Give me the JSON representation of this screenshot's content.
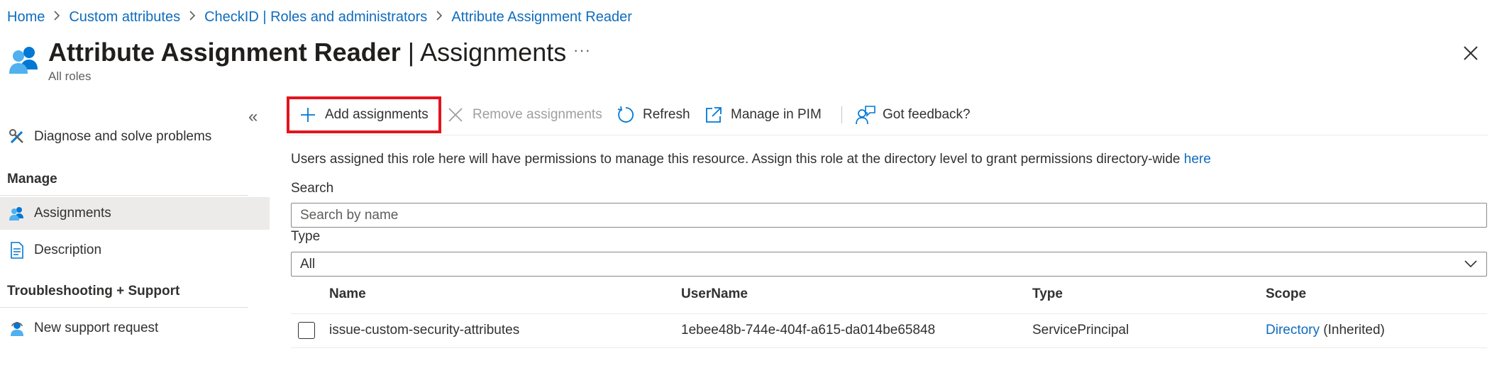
{
  "breadcrumb": {
    "items": [
      "Home",
      "Custom attributes",
      "CheckID | Roles and administrators",
      "Attribute Assignment Reader"
    ]
  },
  "header": {
    "title_bold": "Attribute Assignment Reader",
    "title_separator": " | ",
    "title_light": "Assignments",
    "subtitle": "All roles",
    "more_label": "···"
  },
  "sidebar": {
    "collapse_label": "«",
    "diagnose_label": "Diagnose and solve problems",
    "manage_heading": "Manage",
    "items": [
      {
        "label": "Assignments",
        "icon": "people-icon",
        "selected": true
      },
      {
        "label": "Description",
        "icon": "document-icon",
        "selected": false
      }
    ],
    "troubleshooting_heading": "Troubleshooting + Support",
    "support_label": "New support request"
  },
  "toolbar": {
    "add_label": "Add assignments",
    "remove_label": "Remove assignments",
    "refresh_label": "Refresh",
    "pim_label": "Manage in PIM",
    "feedback_label": "Got feedback?"
  },
  "content": {
    "info_text": "Users assigned this role here will have permissions to manage this resource. Assign this role at the directory level to grant permissions directory-wide ",
    "info_link": "here",
    "search_label": "Search",
    "search_placeholder": "Search by name",
    "type_label": "Type",
    "type_value": "All"
  },
  "table": {
    "columns": [
      "Name",
      "UserName",
      "Type",
      "Scope"
    ],
    "rows": [
      {
        "name": "issue-custom-security-attributes",
        "username": "1ebee48b-744e-404f-a615-da014be65848",
        "type": "ServicePrincipal",
        "scope_link": "Directory",
        "scope_suffix": " (Inherited)"
      }
    ]
  },
  "colors": {
    "accent": "#0f6cbd",
    "highlight_border": "#e3141d",
    "selected_bg": "#edebe9"
  }
}
